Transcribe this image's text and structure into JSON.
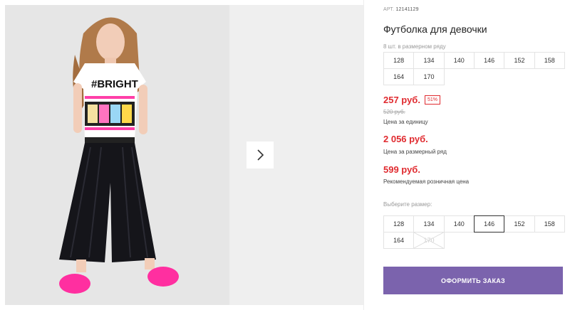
{
  "product": {
    "article_label": "АРТ.",
    "article_number": "12141129",
    "title": "Футболка для девочки",
    "range_note": "8 шт. в размерном ряду"
  },
  "range_sizes": [
    "128",
    "134",
    "140",
    "146",
    "152",
    "158",
    "164",
    "170"
  ],
  "pricing": {
    "unit_price": "257 руб.",
    "discount": "51%",
    "old_price": "520 руб.",
    "unit_label": "Цена за единицу",
    "range_price": "2 056 руб.",
    "range_label": "Цена за размерный ряд",
    "rrp_price": "599 руб.",
    "rrp_label": "Рекомендуемая розничная цена"
  },
  "size_select": {
    "label": "Выберите размер:",
    "options": [
      {
        "label": "128",
        "state": "available"
      },
      {
        "label": "134",
        "state": "available"
      },
      {
        "label": "140",
        "state": "available"
      },
      {
        "label": "146",
        "state": "selected"
      },
      {
        "label": "152",
        "state": "available"
      },
      {
        "label": "158",
        "state": "available"
      },
      {
        "label": "164",
        "state": "available"
      },
      {
        "label": "170",
        "state": "unavailable"
      }
    ]
  },
  "order_button": "ОФОРМИТЬ ЗАКАЗ",
  "photo_print": "#BRIGHT",
  "colors": {
    "accent_price": "#e02a2f",
    "button": "#7b63ad"
  },
  "icons": {
    "next": "chevron-right-icon"
  }
}
